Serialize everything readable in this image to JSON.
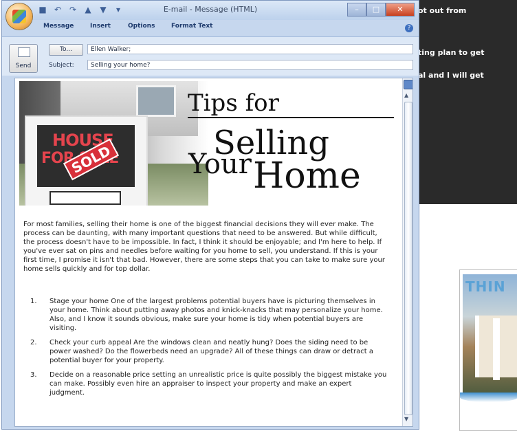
{
  "background_window": {
    "line1": "ot out from",
    "line2": "ting plan to get",
    "line3": "al and I will get"
  },
  "flyer": {
    "title": "THIN"
  },
  "window": {
    "title": "E-mail - Message (HTML)",
    "ribbon_tabs": [
      "Message",
      "Insert",
      "Options",
      "Format Text"
    ],
    "help": "?"
  },
  "compose": {
    "send_label": "Send",
    "to_button": "To...",
    "to_value": "Ellen Walker;",
    "subject_label": "Subject:",
    "subject_value": "Selling your home?"
  },
  "email": {
    "banner": {
      "tips_for": "Tips for",
      "selling": "Selling",
      "your": "Your",
      "home": "Home",
      "sign_house": "HOUSE",
      "sign_forsale": "FOR SALE",
      "sign_sold": "SOLD"
    },
    "intro": "For most families, selling their home is one of the biggest financial decisions they will ever make. The process can be daunting, with many important questions that need to be answered. But while difficult, the process doesn't have to be impossible.  In fact, I think it should be enjoyable; and I'm here to help.  If you've ever sat on pins and needles before waiting for you home to sell, you understand.  If this is your first time, I promise it isn't that bad.  However, there are some steps that you can take to make sure your home sells quickly and for top dollar.",
    "tips": [
      {
        "num": "1.",
        "text": "Stage your home One of the largest problems potential buyers have is picturing themselves in your home.  Think about putting away photos and knick-knacks that may personalize your home.  Also, and I know it sounds obvious, make sure your home is tidy when potential buyers are visiting."
      },
      {
        "num": "2.",
        "text": "Check your curb appeal Are the windows clean and neatly hung? Does the siding need to be power washed? Do the flowerbeds need an upgrade?  All of these things can draw or detract a potential buyer for your property."
      },
      {
        "num": "3.",
        "text": "Decide on a reasonable price setting an unrealistic price is quite possibly the biggest mistake you can make.  Possibly even hire an appraiser to inspect your property and make an expert judgment."
      }
    ]
  }
}
